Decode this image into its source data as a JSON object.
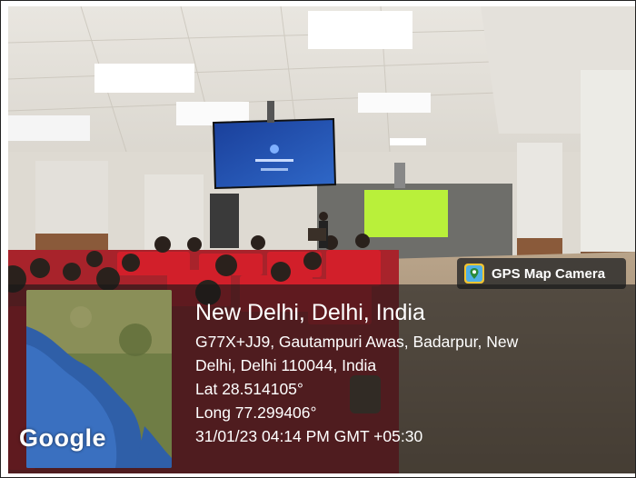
{
  "overlay": {
    "app_name": "GPS Map Camera",
    "app_icon": "gps-map-camera-icon",
    "map_brand": "Google",
    "location_title": "New Delhi, Delhi, India",
    "address_line_1": "G77X+JJ9, Gautampuri Awas, Badarpur, New",
    "address_line_2": "Delhi, Delhi 110044, India",
    "latitude": "Lat 28.514105°",
    "longitude": "Long 77.299406°",
    "timestamp": "31/01/23 04:14 PM GMT +05:30"
  },
  "tv_screen": {
    "caption": "Cisco Webex",
    "subcaption": "Join a meeting"
  },
  "colors": {
    "overlay_bg": "#191919",
    "seat_red": "#d21f2a",
    "projection_green": "#b9f03a",
    "tv_blue": "#1e4aa8"
  }
}
